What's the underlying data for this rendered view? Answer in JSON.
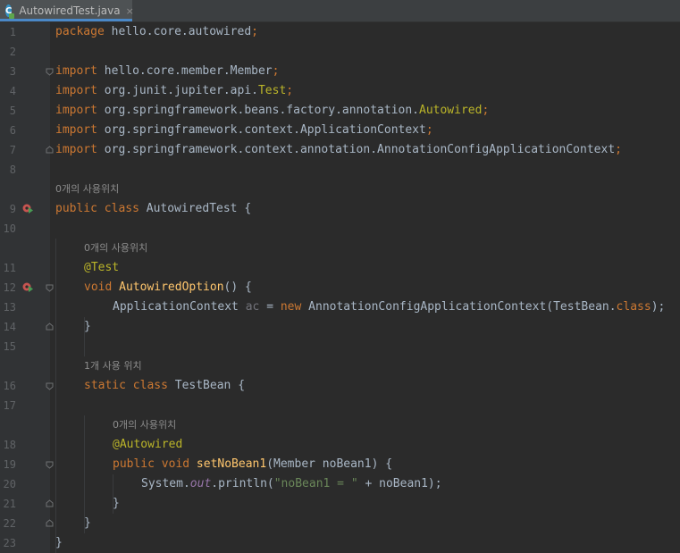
{
  "tab": {
    "file_name": "AutowiredTest.java",
    "close_label": "×"
  },
  "lines": {
    "n1": "1",
    "n2": "2",
    "n3": "3",
    "n4": "4",
    "n5": "5",
    "n6": "6",
    "n7": "7",
    "n8": "8",
    "n9": "9",
    "n10": "10",
    "n11": "11",
    "n12": "12",
    "n13": "13",
    "n14": "14",
    "n15": "15",
    "n16": "16",
    "n17": "17",
    "n18": "18",
    "n19": "19",
    "n20": "20",
    "n21": "21",
    "n22": "22",
    "n23": "23"
  },
  "code": {
    "l1_kw": "package",
    "l1_rest": " hello.core.autowired",
    "l1_semi": ";",
    "l3_kw": "import",
    "l3_rest": " hello.core.member.Member",
    "l3_semi": ";",
    "l4_kw": "import",
    "l4_rest": " org.junit.jupiter.api.",
    "l4_ann": "Test",
    "l4_semi": ";",
    "l5_kw": "import",
    "l5_rest": " org.springframework.beans.factory.annotation.",
    "l5_ann": "Autowired",
    "l5_semi": ";",
    "l6_kw": "import",
    "l6_rest": " org.springframework.context.ApplicationContext",
    "l6_semi": ";",
    "l7_kw": "import",
    "l7_rest": " org.springframework.context.annotation.AnnotationConfigApplicationContext",
    "l7_semi": ";",
    "hint_class": "0개의 사용위치",
    "l9_kw": "public class",
    "l9_rest": " AutowiredTest {",
    "hint_method": "0개의 사용위치",
    "l11_ann": "@Test",
    "l12_kw": "void",
    "l12_fn": " AutowiredOption",
    "l12_rest": "() {",
    "l13_a": "ApplicationContext ",
    "l13_var": "ac",
    "l13_b": " = ",
    "l13_kw": "new",
    "l13_c": " AnnotationConfigApplicationContext(TestBean.",
    "l13_kw2": "class",
    "l13_d": ");",
    "l14": "}",
    "hint_bean": "1개 사용 위치",
    "l16_kw": "static class",
    "l16_rest": " TestBean {",
    "hint_setter": "0개의 사용위치",
    "l18_ann": "@Autowired",
    "l19_kw": "public void",
    "l19_fn": " setNoBean1",
    "l19_rest": "(Member noBean1) {",
    "l20_a": "System.",
    "l20_st": "out",
    "l20_b": ".println(",
    "l20_str": "\"noBean1 = \"",
    "l20_c": " + noBean1);",
    "l21": "}",
    "l22": "}",
    "l23": "}"
  },
  "colors": {
    "keyword": "#cc7832",
    "annotation": "#bbb529",
    "method": "#ffc66d",
    "string": "#6a8759",
    "static_field": "#9876aa",
    "text": "#a9b7c6"
  },
  "icons": {
    "run_class": "run-test-icon",
    "run_method": "run-test-icon",
    "file": "java-class-icon"
  }
}
